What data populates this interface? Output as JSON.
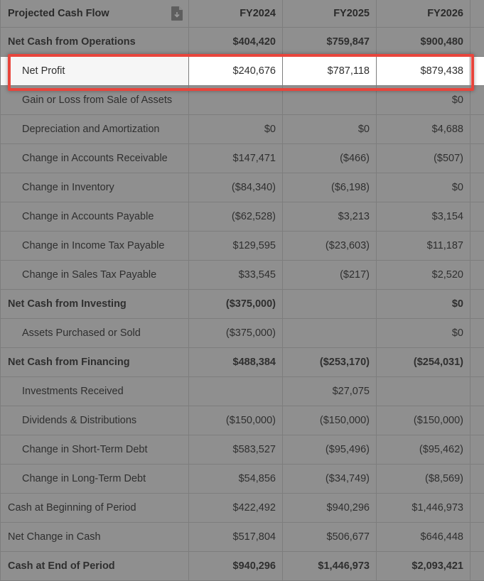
{
  "header": {
    "title": "Projected Cash Flow",
    "years": [
      "FY2024",
      "FY2025",
      "FY2026"
    ],
    "export_icon": "document-download-icon"
  },
  "rows": [
    {
      "label": "Net Cash from Operations",
      "values": [
        "$404,420",
        "$759,847",
        "$900,480"
      ],
      "style": "bold"
    },
    {
      "label": "Net Profit",
      "values": [
        "$240,676",
        "$787,118",
        "$879,438"
      ],
      "style": "highlight"
    },
    {
      "label": "Gain or Loss from Sale of Assets",
      "values": [
        "",
        "",
        "$0"
      ],
      "style": "sub"
    },
    {
      "label": "Depreciation and Amortization",
      "values": [
        "$0",
        "$0",
        "$4,688"
      ],
      "style": "sub"
    },
    {
      "label": "Change in Accounts Receivable",
      "values": [
        "$147,471",
        "($466)",
        "($507)"
      ],
      "style": "sub"
    },
    {
      "label": "Change in Inventory",
      "values": [
        "($84,340)",
        "($6,198)",
        "$0"
      ],
      "style": "sub"
    },
    {
      "label": "Change in Accounts Payable",
      "values": [
        "($62,528)",
        "$3,213",
        "$3,154"
      ],
      "style": "sub"
    },
    {
      "label": "Change in Income Tax Payable",
      "values": [
        "$129,595",
        "($23,603)",
        "$11,187"
      ],
      "style": "sub"
    },
    {
      "label": "Change in Sales Tax Payable",
      "values": [
        "$33,545",
        "($217)",
        "$2,520"
      ],
      "style": "sub"
    },
    {
      "label": "Net Cash from Investing",
      "values": [
        "($375,000)",
        "",
        "$0"
      ],
      "style": "bold"
    },
    {
      "label": "Assets Purchased or Sold",
      "values": [
        "($375,000)",
        "",
        "$0"
      ],
      "style": "sub"
    },
    {
      "label": "Net Cash from Financing",
      "values": [
        "$488,384",
        "($253,170)",
        "($254,031)"
      ],
      "style": "bold"
    },
    {
      "label": "Investments Received",
      "values": [
        "",
        "$27,075",
        ""
      ],
      "style": "sub"
    },
    {
      "label": "Dividends & Distributions",
      "values": [
        "($150,000)",
        "($150,000)",
        "($150,000)"
      ],
      "style": "sub"
    },
    {
      "label": "Change in Short-Term Debt",
      "values": [
        "$583,527",
        "($95,496)",
        "($95,462)"
      ],
      "style": "sub"
    },
    {
      "label": "Change in Long-Term Debt",
      "values": [
        "$54,856",
        "($34,749)",
        "($8,569)"
      ],
      "style": "sub"
    },
    {
      "label": "Cash at Beginning of Period",
      "values": [
        "$422,492",
        "$940,296",
        "$1,446,973"
      ],
      "style": "normal"
    },
    {
      "label": "Net Change in Cash",
      "values": [
        "$517,804",
        "$506,677",
        "$646,448"
      ],
      "style": "normal"
    },
    {
      "label": "Cash at End of Period",
      "values": [
        "$940,296",
        "$1,446,973",
        "$2,093,421"
      ],
      "style": "bold"
    }
  ]
}
